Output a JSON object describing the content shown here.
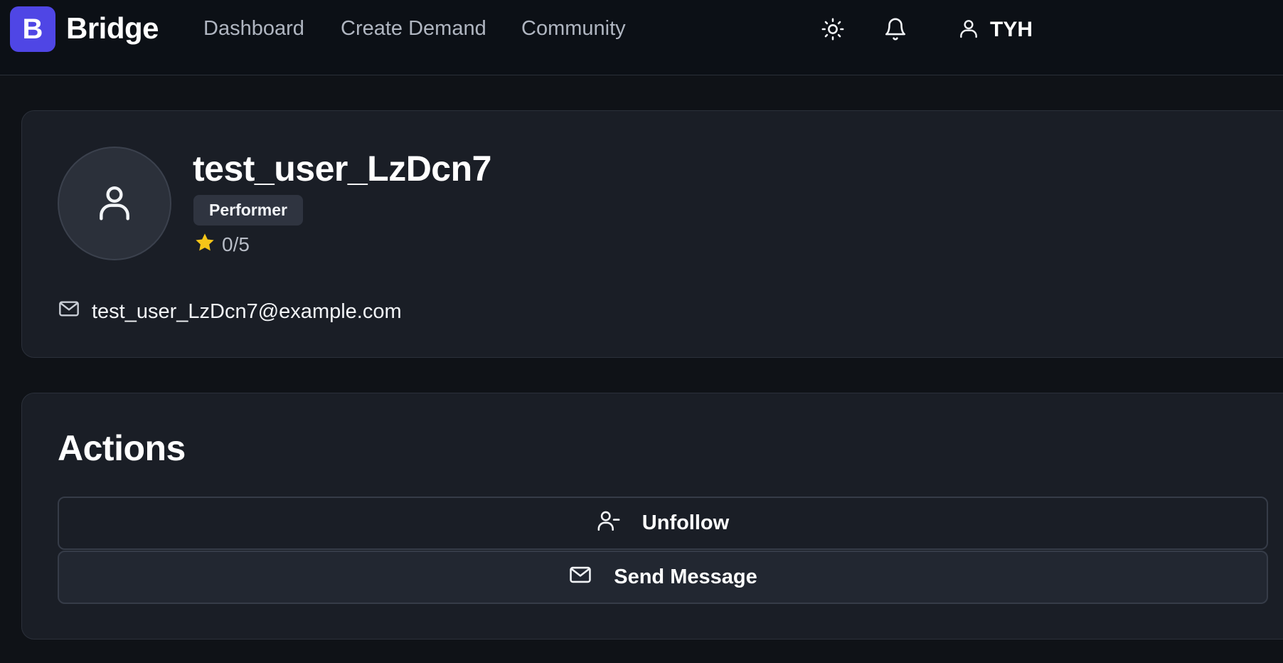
{
  "navbar": {
    "logo_letter": "B",
    "brand": "Bridge",
    "links": [
      "Dashboard",
      "Create Demand",
      "Community"
    ],
    "icons": [
      "sun-icon",
      "bell-icon",
      "user-icon"
    ],
    "user_name": "TYH"
  },
  "profile": {
    "username": "test_user_LzDcn7",
    "role": "Performer",
    "rating": "0/5",
    "rating_icon": "star-icon",
    "email": "test_user_LzDcn7@example.com"
  },
  "actions": {
    "title": "Actions",
    "unfollow_label": "Unfollow",
    "message_label": "Send Message"
  },
  "colors": {
    "accent": "#4f46e5",
    "star": "#f5c518",
    "background": "#0f1217",
    "card": "#1a1e26"
  }
}
